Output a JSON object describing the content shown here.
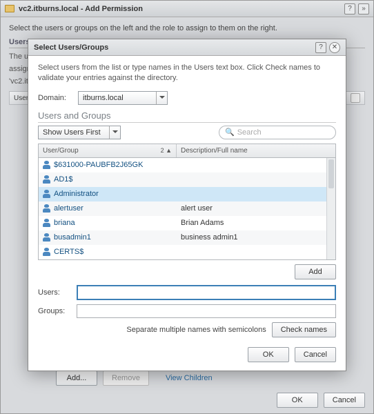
{
  "outer": {
    "title": "vc2.itburns.local - Add Permission",
    "hint": "Select the users or groups on the left and the role to assign to them on the right.",
    "usersLabel": "Users",
    "bgText1": "The us",
    "bgText2": "assigne",
    "bgText3": "'vc2.itb",
    "userGroupCol": "User/G",
    "addBtn": "Add...",
    "removeBtn": "Remove",
    "viewChildren": "View Children",
    "okBtn": "OK",
    "cancelBtn": "Cancel"
  },
  "modal": {
    "title": "Select Users/Groups",
    "instruction": "Select users from the list or type names in the Users text box. Click Check names to validate your entries against the directory.",
    "domainLabel": "Domain:",
    "domainValue": "itburns.local",
    "sectionTitle": "Users and Groups",
    "showModeValue": "Show Users First",
    "searchPlaceholder": "Search",
    "colUserGroup": "User/Group",
    "sortIndicator": "2 ▲",
    "colDescription": "Description/Full name",
    "rows": [
      {
        "name": "$631000-PAUBFB2J65GK",
        "desc": ""
      },
      {
        "name": "AD1$",
        "desc": ""
      },
      {
        "name": "Administrator",
        "desc": ""
      },
      {
        "name": "alertuser",
        "desc": "alert user"
      },
      {
        "name": "briana",
        "desc": "Brian Adams"
      },
      {
        "name": "busadmin1",
        "desc": "business admin1"
      },
      {
        "name": "CERTS$",
        "desc": ""
      }
    ],
    "selectedIndex": 2,
    "addBtn": "Add",
    "usersLabel": "Users:",
    "groupsLabel": "Groups:",
    "usersValue": "",
    "groupsValue": "",
    "separateHint": "Separate multiple names with semicolons",
    "checkNamesBtn": "Check names",
    "okBtn": "OK",
    "cancelBtn": "Cancel"
  }
}
